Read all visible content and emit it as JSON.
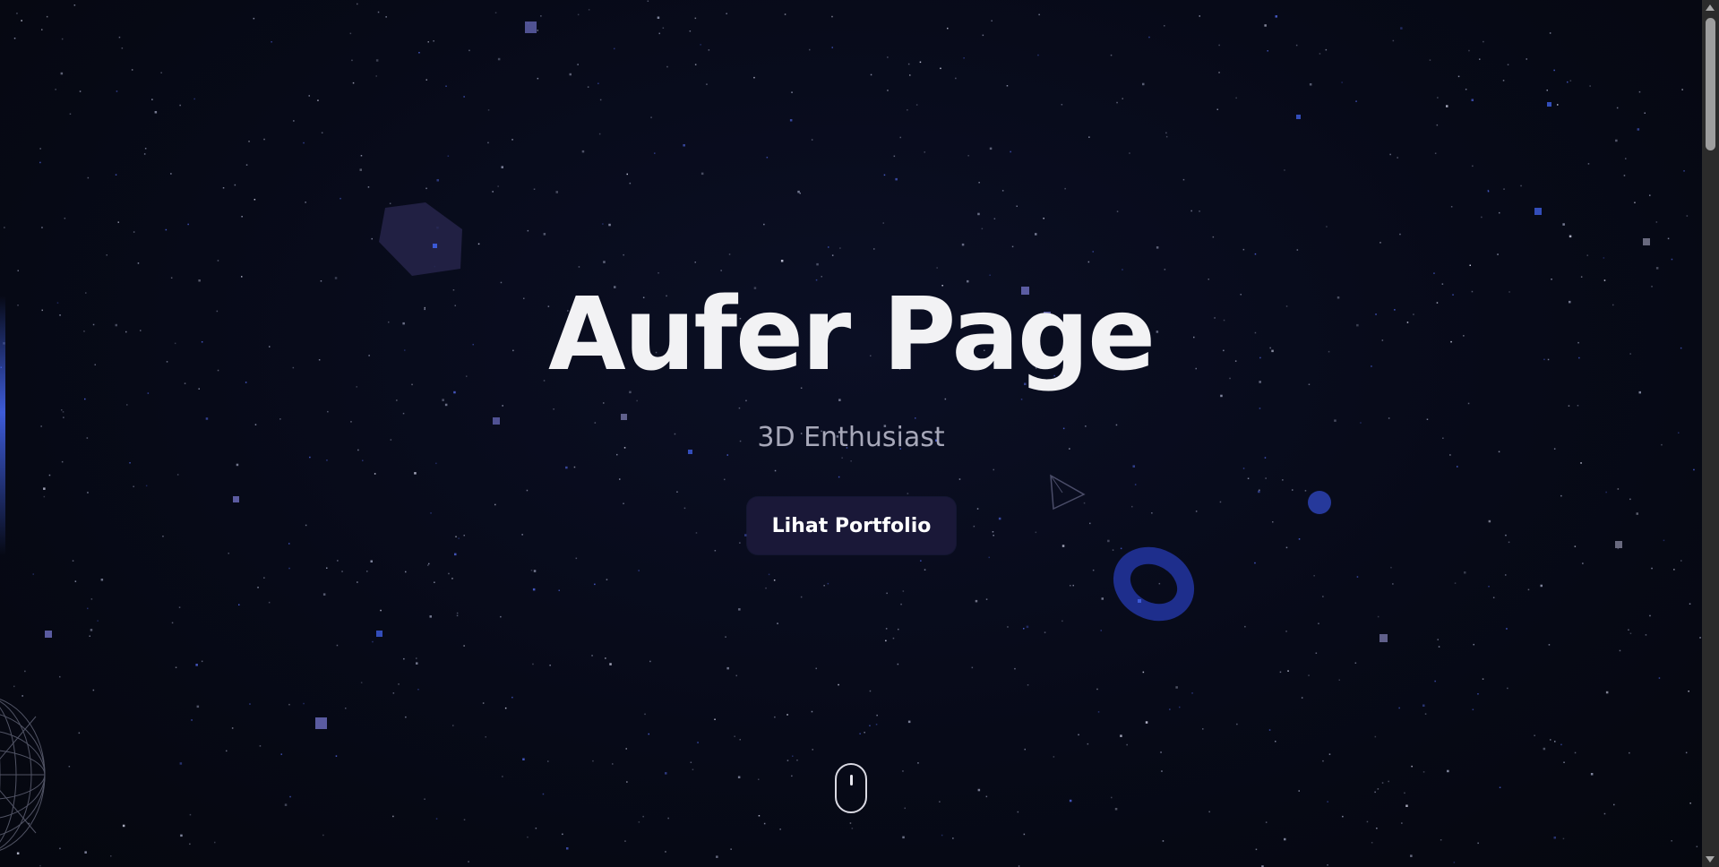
{
  "hero": {
    "title": "Aufer Page",
    "subtitle": "3D Enthusiast",
    "cta_label": "Lihat Portfolio"
  },
  "icons": {
    "scroll_indicator": "mouse-scroll-icon"
  },
  "colors": {
    "background": "#070a18",
    "title": "#f2f2f4",
    "subtitle": "#a7a8b9",
    "button_bg": "#1a1838",
    "accent_blue": "#3d5bd8",
    "accent_purple": "#6b6bc0"
  }
}
